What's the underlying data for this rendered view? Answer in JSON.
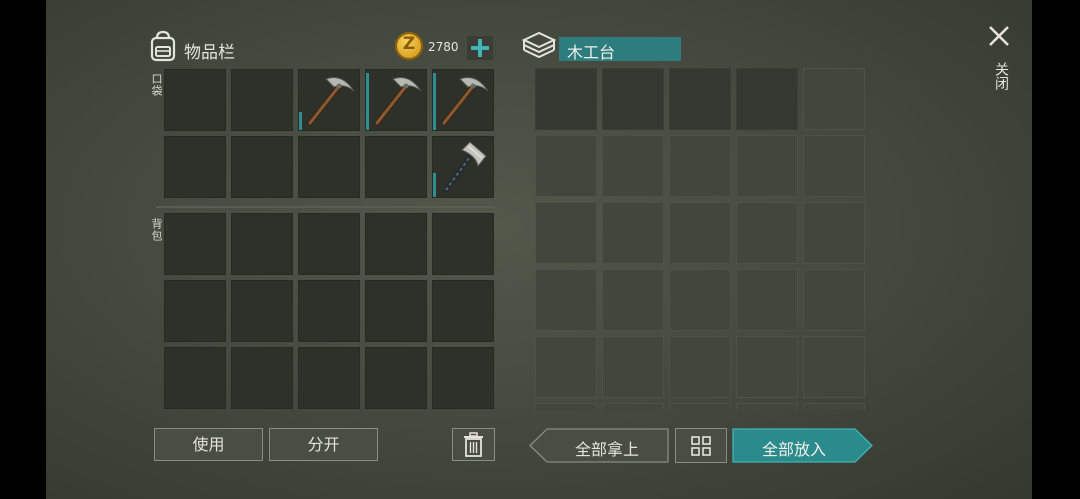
{
  "inventory": {
    "title": "物品栏",
    "coin_symbol": "Z",
    "coins": "2780",
    "pocket_label": "口袋",
    "backpack_label": "背包"
  },
  "workbench": {
    "title": "木工台"
  },
  "close": {
    "label": "关闭"
  },
  "buttons": {
    "use": "使用",
    "split": "分开",
    "take_all": "全部拿上",
    "put_all": "全部放入"
  },
  "pocket_slots": [
    {
      "item": "empty"
    },
    {
      "item": "empty"
    },
    {
      "item": "pickaxe",
      "durability": 0.3
    },
    {
      "item": "pickaxe",
      "durability": 0.95
    },
    {
      "item": "pickaxe",
      "durability": 0.95
    },
    {
      "item": "empty"
    },
    {
      "item": "empty"
    },
    {
      "item": "empty"
    },
    {
      "item": "empty"
    },
    {
      "item": "hatchet",
      "durability": 0.4
    }
  ],
  "colors": {
    "accent": "#2d8f92",
    "accent_bright": "#3fb5b5",
    "coin": "#d9a21b"
  }
}
